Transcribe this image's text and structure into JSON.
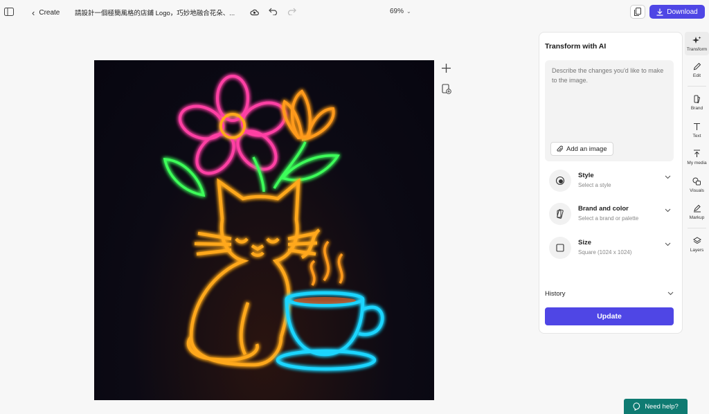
{
  "header": {
    "back_label": "Create",
    "doc_title": "請設計一個極簡風格的店鋪 Logo，巧妙地融合花朵、...",
    "zoom": "69%",
    "download_label": "Download"
  },
  "panel": {
    "title": "Transform with AI",
    "prompt_placeholder": "Describe the changes you'd like to make to the image.",
    "add_image_label": "Add an image",
    "options": [
      {
        "label": "Style",
        "sub": "Select a style",
        "icon": "style-icon"
      },
      {
        "label": "Brand and color",
        "sub": "Select a brand or palette",
        "icon": "brand-icon"
      },
      {
        "label": "Size",
        "sub": "Square (1024 x 1024)",
        "icon": "square-icon"
      }
    ],
    "history_label": "History",
    "update_label": "Update"
  },
  "rail": {
    "items": [
      {
        "label": "Transform",
        "icon": "sparkle-icon"
      },
      {
        "label": "Edit",
        "icon": "pencil-icon"
      },
      {
        "label": "Brand",
        "icon": "brand-icon"
      },
      {
        "label": "Text",
        "icon": "text-icon"
      },
      {
        "label": "My media",
        "icon": "upload-icon"
      },
      {
        "label": "Visuals",
        "icon": "shapes-icon"
      },
      {
        "label": "Markup",
        "icon": "pen-icon"
      },
      {
        "label": "Layers",
        "icon": "layers-icon"
      }
    ]
  },
  "help": {
    "label": "Need help?"
  },
  "colors": {
    "accent": "#4f46e5",
    "help": "#0f7b72",
    "neon_pink": "#ff3fa4",
    "neon_orange": "#ffa81f",
    "neon_green": "#3dff5a",
    "neon_cyan": "#1fd5ff"
  }
}
